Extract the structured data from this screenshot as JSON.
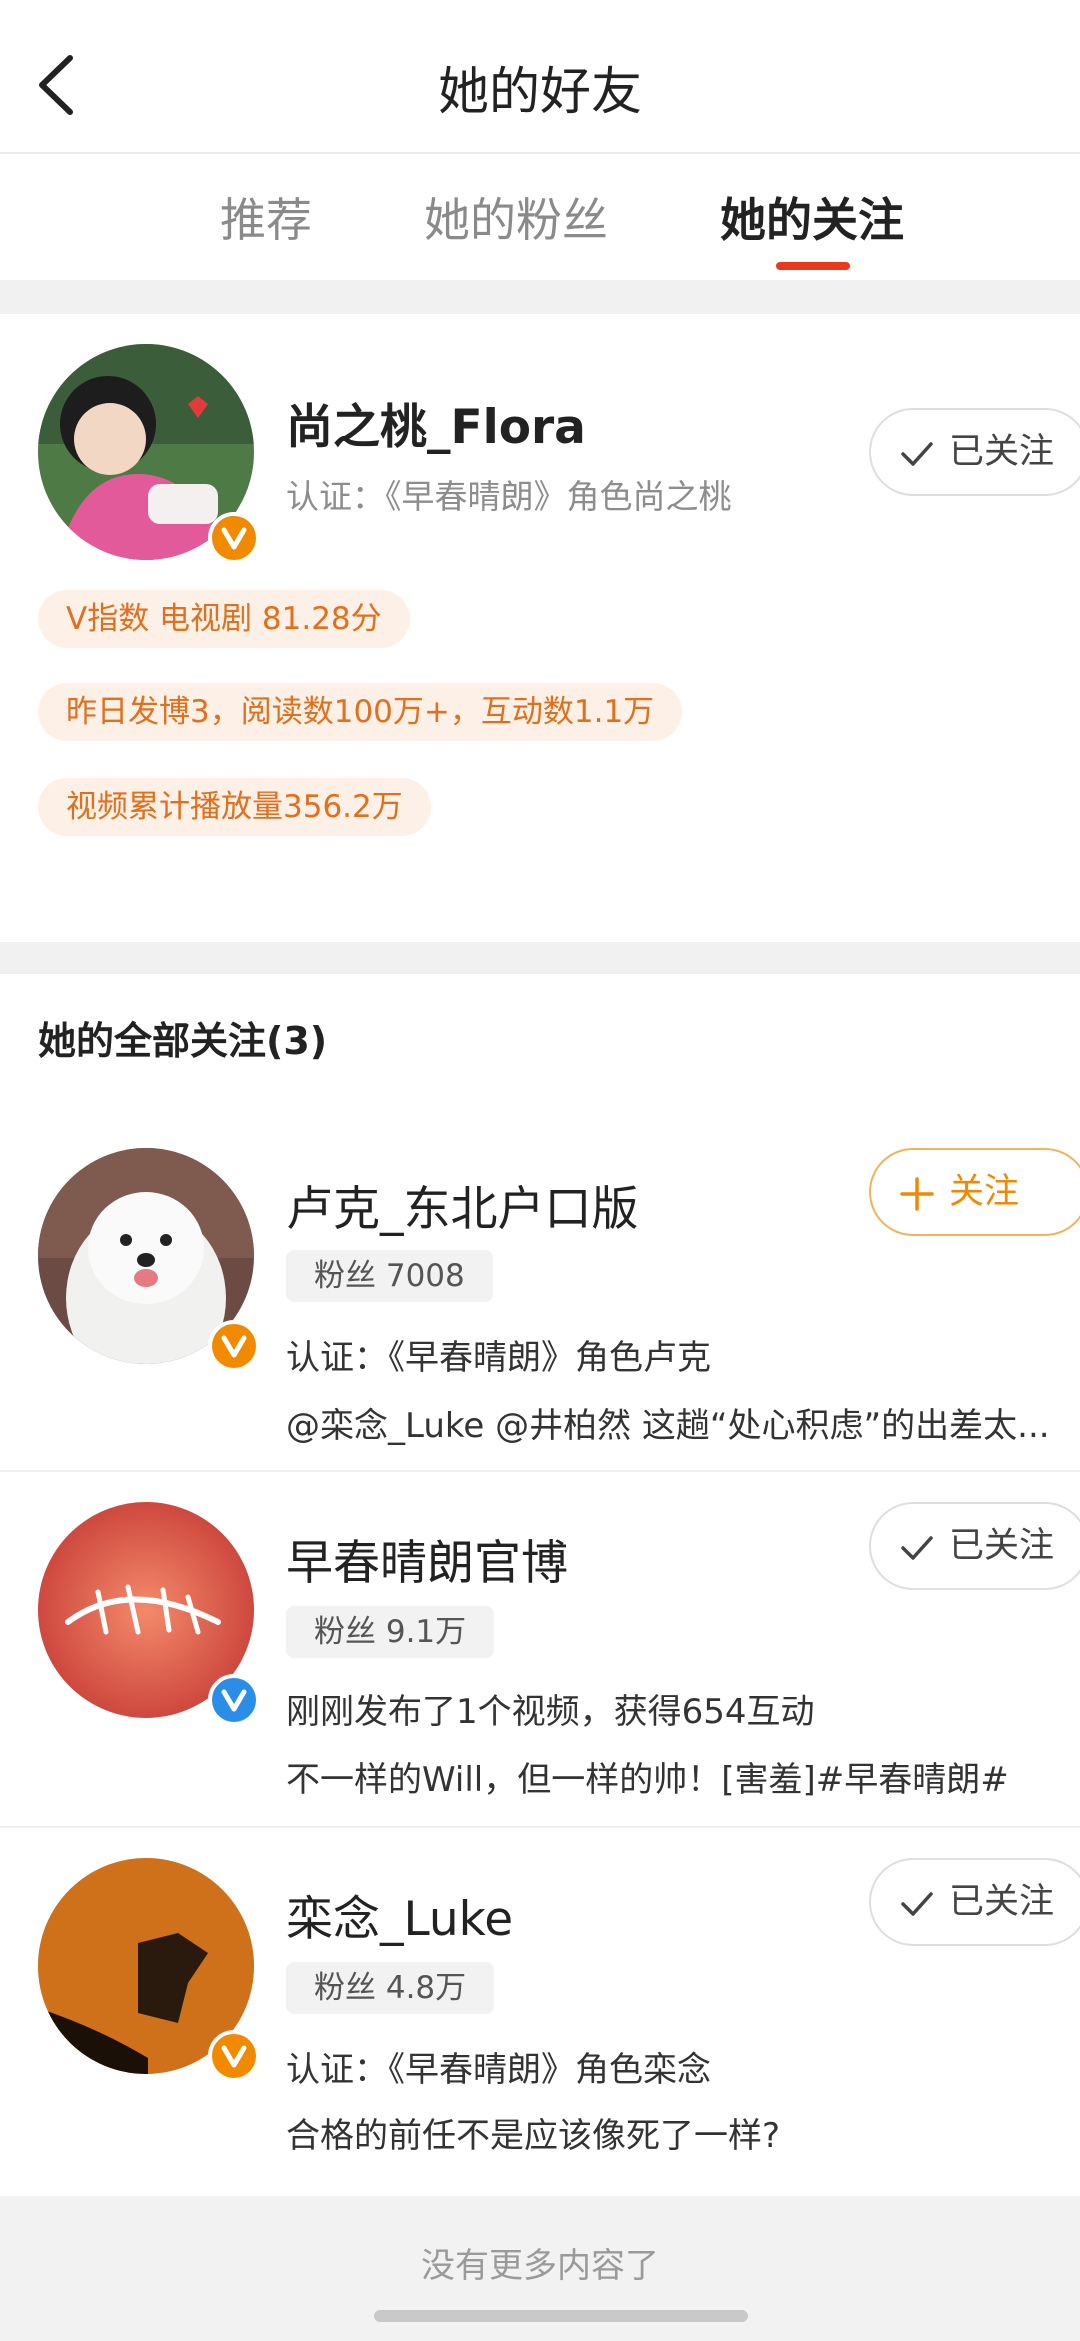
{
  "header": {
    "title": "她的好友",
    "back_icon": "chevron-left-icon"
  },
  "tabs": [
    {
      "label": "推荐",
      "active": false
    },
    {
      "label": "她的粉丝",
      "active": false
    },
    {
      "label": "她的关注",
      "active": true
    }
  ],
  "featured": {
    "name": "尚之桃_Flora",
    "verification": "认证：《早春晴朗》角色尚之桃",
    "button": {
      "label": "已关注",
      "icon": "check-icon"
    },
    "badge_color": "#f28a00",
    "stats": [
      "V指数 电视剧 81.28分",
      "昨日发博3，阅读数100万+，互动数1.1万",
      "视频累计播放量356.2万"
    ]
  },
  "section": {
    "title": "她的全部关注(3)"
  },
  "users": [
    {
      "name": "卢克_东北户口版",
      "fans": "粉丝 7008",
      "line1": "认证：《早春晴朗》角色卢克",
      "line2": "@栾念_Luke @井柏然 这趟“处心积虑”的出差太...",
      "button": {
        "label": "关注",
        "icon": "plus-icon",
        "followed": false
      },
      "badge_color": "#f28a00"
    },
    {
      "name": "早春晴朗官博",
      "fans": "粉丝 9.1万",
      "line1": "刚刚发布了1个视频，获得654互动",
      "line2": "不一样的Will，但一样的帅！[害羞]#早春晴朗#",
      "button": {
        "label": "已关注",
        "icon": "check-icon",
        "followed": true
      },
      "badge_color": "#2a8ee8"
    },
    {
      "name": "栾念_Luke",
      "fans": "粉丝 4.8万",
      "line1": "认证：《早春晴朗》角色栾念",
      "line2": "合格的前任不是应该像死了一样?",
      "button": {
        "label": "已关注",
        "icon": "check-icon",
        "followed": true
      },
      "badge_color": "#f28a00"
    }
  ],
  "footer": {
    "text": "没有更多内容了"
  }
}
